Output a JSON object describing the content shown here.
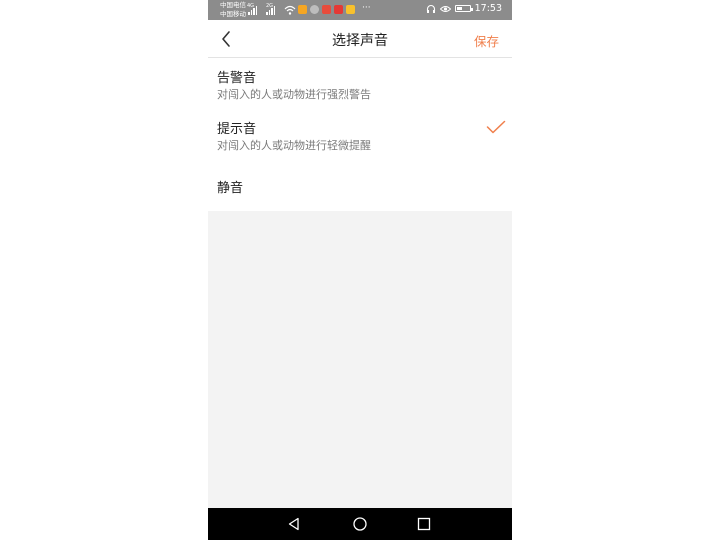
{
  "status_bar": {
    "carrier_1": "中国电信",
    "carrier_2": "中国移动",
    "network_tag_1": "4G",
    "network_tag_2": "2G",
    "time": "17:53",
    "icons": [
      "signal-icon",
      "wifi-icon",
      "app-notification-icons",
      "headset-icon",
      "eye-icon",
      "battery-icon"
    ],
    "overflow": "···"
  },
  "header": {
    "title": "选择声音",
    "save_label": "保存",
    "back_icon": "chevron-left-icon"
  },
  "options": [
    {
      "name": "告警音",
      "description": "对闯入的人或动物进行强烈警告",
      "selected": false
    },
    {
      "name": "提示音",
      "description": "对闯入的人或动物进行轻微提醒",
      "selected": true
    },
    {
      "name": "静音",
      "description": "",
      "selected": false
    }
  ],
  "nav_bar": {
    "icons": [
      "back-triangle-icon",
      "home-circle-icon",
      "recents-square-icon"
    ]
  },
  "colors": {
    "accent": "#f07f4c",
    "status_bar": "#8c8c8c",
    "background": "#f3f3f3",
    "nav_bar": "#000000"
  }
}
